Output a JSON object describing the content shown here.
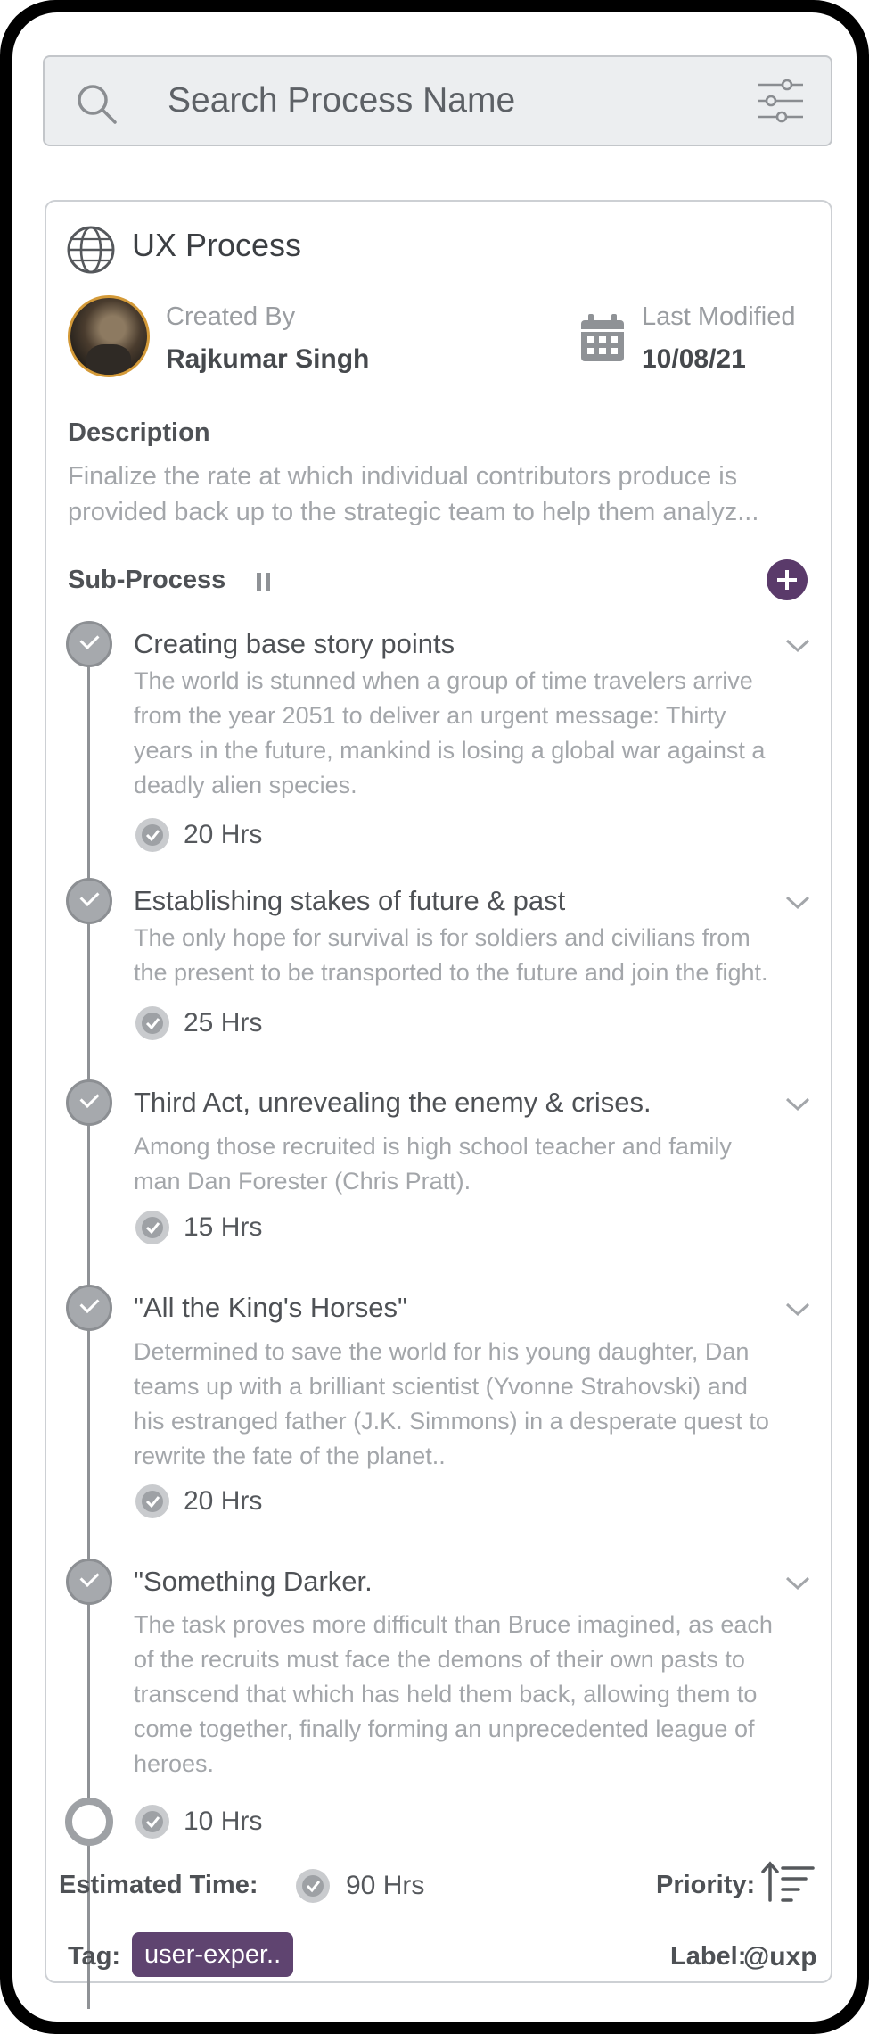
{
  "search": {
    "placeholder": "Search Process Name",
    "search_icon": "search-icon",
    "filter_icon": "filter-sliders-icon"
  },
  "process": {
    "icon": "globe-icon",
    "title": "UX Process",
    "created_by_label": "Created By",
    "created_by": "Rajkumar Singh",
    "last_modified_label": "Last Modified",
    "last_modified": "10/08/21",
    "description_label": "Description",
    "description_line1": "Finalize the rate at which individual contributors produce is",
    "description_line2": "provided back up to the strategic team to help them analyz...",
    "subprocess_label": "Sub-Process"
  },
  "steps": [
    {
      "title": "Creating base story points",
      "lines": [
        "The world is stunned when a group of time travelers arrive",
        "from the year 2051 to deliver an urgent message: Thirty",
        "years in the future, mankind is losing a global war against a",
        "deadly alien species."
      ],
      "hours": "20 Hrs"
    },
    {
      "title": "Establishing stakes of future & past",
      "lines": [
        "The only hope for survival is for soldiers and civilians from",
        "the present to be transported to the future and join the fight."
      ],
      "hours": "25 Hrs"
    },
    {
      "title": "Third Act, unrevealing the enemy & crises.",
      "lines": [
        "Among those recruited is high school teacher and family",
        "man Dan Forester (Chris Pratt)."
      ],
      "hours": "15 Hrs"
    },
    {
      "title": "\"All the King's Horses\"",
      "lines": [
        "Determined to save the world for his young daughter, Dan",
        "teams up with a brilliant scientist (Yvonne Strahovski) and",
        "his estranged father (J.K. Simmons) in a desperate quest to",
        "rewrite the fate of the planet.."
      ],
      "hours": "20 Hrs"
    },
    {
      "title": "\"Something Darker.",
      "lines": [
        "The task proves more difficult than Bruce imagined, as each",
        "of the recruits must face the demons of their own pasts to",
        "transcend that which has held them back, allowing them to",
        "come together, finally forming an unprecedented league of",
        "heroes."
      ],
      "hours": "10 Hrs"
    }
  ],
  "footer": {
    "estimated_label": "Estimated Time:",
    "estimated_value": "90 Hrs",
    "priority_label": "Priority:",
    "tag_label": "Tag:",
    "tag_value": "user-exper..",
    "label_label": "Label:",
    "label_value": "@uxp"
  },
  "colors": {
    "accent": "#5a3a6a",
    "tag_bg": "#5f4470",
    "avatar_ring": "#d49a38"
  }
}
